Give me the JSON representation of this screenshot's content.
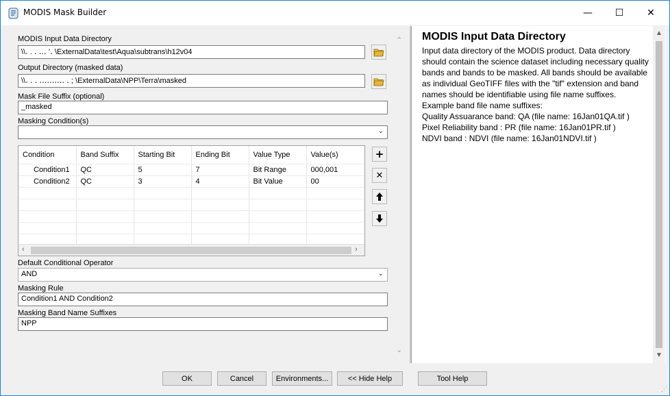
{
  "window": {
    "title": "MODIS Mask Builder",
    "controls": {
      "minimize": "—",
      "maximize": "☐",
      "close": "✕"
    }
  },
  "form": {
    "input_dir": {
      "label": "MODIS Input Data Directory",
      "value": "\\\\․  .               ․ ․․․     ’․  \\ExternalData\\test\\Aqua\\subtrans\\h12v04",
      "icon": "open-folder-icon"
    },
    "output_dir": {
      "label": "Output Directory (masked data)",
      "value": "\\\\․  ․ ․ ․․․․․․․․․․ ․    ;   \\ExternalData\\NPP\\Terra\\masked",
      "icon": "open-folder-icon"
    },
    "suffix": {
      "label": "Mask File Suffix (optional)",
      "value": "_masked"
    },
    "masking_condition": {
      "label": "Masking Condition(s)",
      "value": ""
    },
    "conditions_table": {
      "columns": [
        "Condition",
        "Band Suffix",
        "Starting Bit",
        "Ending Bit",
        "Value Type",
        "Value(s)"
      ],
      "rows": [
        [
          "Condition1",
          "QC",
          "5",
          "7",
          "Bit Range",
          "000,001"
        ],
        [
          "Condition2",
          "QC",
          "3",
          "4",
          "Bit Value",
          "00"
        ]
      ]
    },
    "side_buttons": {
      "add": "+",
      "remove": "✕",
      "up": "🡅",
      "down": "🡇"
    },
    "operator": {
      "label": "Default Conditional Operator",
      "value": "AND"
    },
    "rule": {
      "label": "Masking Rule",
      "value": "Condition1 AND Condition2"
    },
    "band_suffixes": {
      "label": "Masking Band Name Suffixes",
      "value": "NPP"
    }
  },
  "help": {
    "title": "MODIS Input Data Directory",
    "lines": [
      "Input data directory of the MODIS product. Data directory should contain the science dataset including necessary quality bands and bands to be masked. All bands should be available as individual GeoTIFF files with the \"tif\" extension and band names should be identifiable using file name suffixes.",
      "Example band file name suffixes:",
      "Quality Assuarance band: QA (file name: 16Jan01QA.tif )",
      "Pixel Reliability band : PR (file name: 16Jan01PR.tif )",
      "NDVI band : NDVI (file name: 16Jan01NDVI.tif )"
    ]
  },
  "buttons": {
    "ok": "OK",
    "cancel": "Cancel",
    "environments": "Environments...",
    "hide_help": "<< Hide Help",
    "tool_help": "Tool Help"
  },
  "colors": {
    "title_border": "#1883d7",
    "panel_bg": "#f0f0f0",
    "folder": "#e8b53a"
  }
}
